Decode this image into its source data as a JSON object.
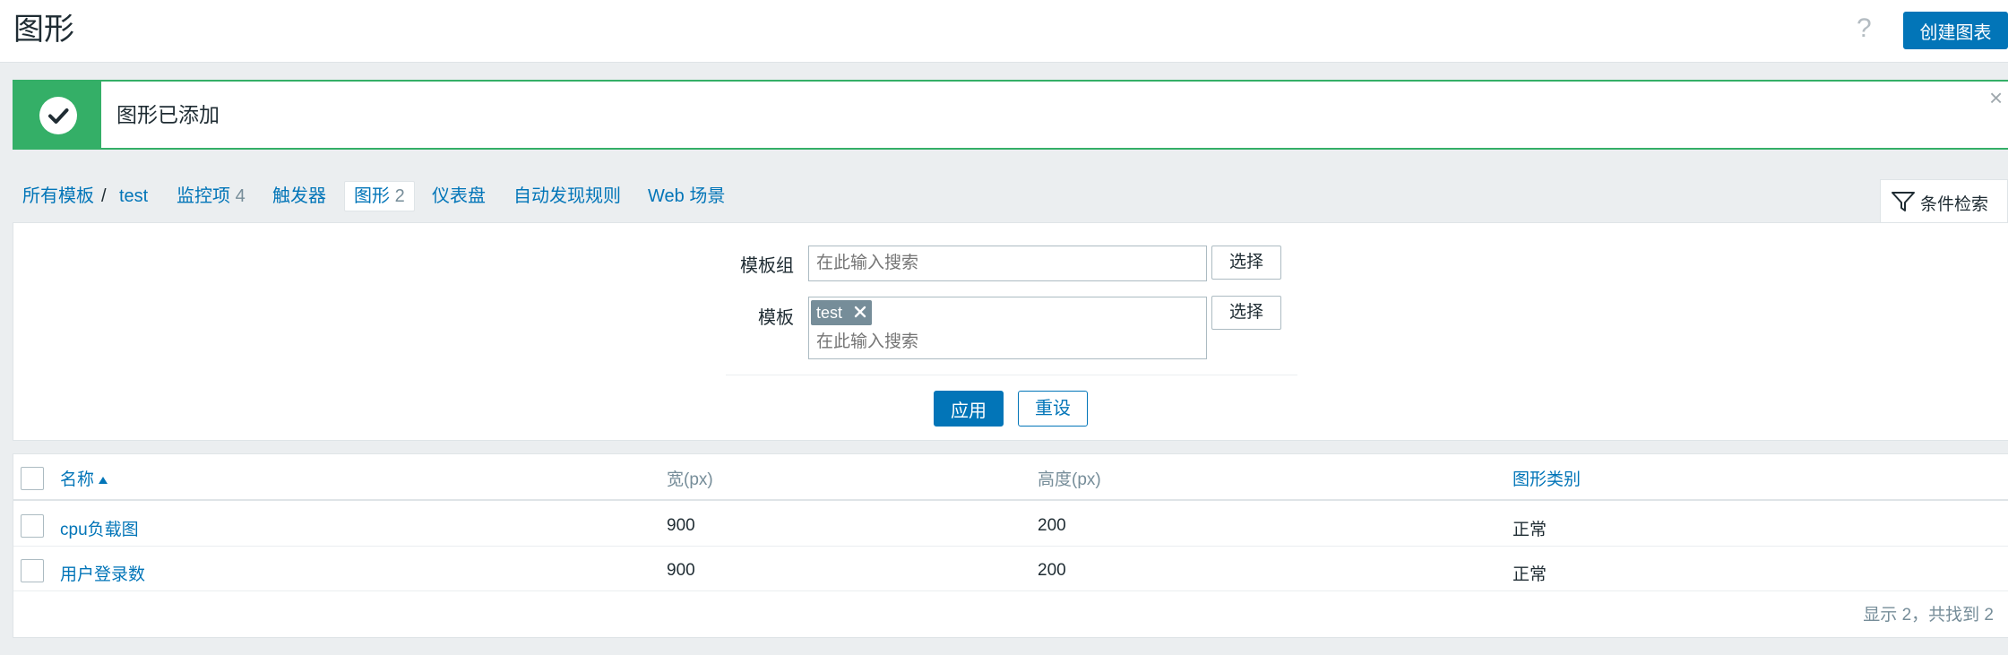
{
  "header": {
    "title": "图形",
    "help_icon": "?",
    "create_button": "创建图表"
  },
  "message": {
    "text": "图形已添加",
    "close": "×",
    "color": "#34af67"
  },
  "breadcrumb": {
    "all_templates": "所有模板",
    "separator": "/",
    "template": "test"
  },
  "tabs": [
    {
      "label": "监控项",
      "count": "4"
    },
    {
      "label": "触发器",
      "count": ""
    },
    {
      "label": "图形",
      "count": "2"
    },
    {
      "label": "仪表盘",
      "count": ""
    },
    {
      "label": "自动发现规则",
      "count": ""
    },
    {
      "label": "Web 场景",
      "count": ""
    }
  ],
  "filter": {
    "tab_label": "条件检索",
    "template_group_label": "模板组",
    "template_label": "模板",
    "placeholder": "在此输入搜索",
    "select_label": "选择",
    "selected_tag": "test",
    "apply_label": "应用",
    "reset_label": "重设"
  },
  "table": {
    "columns": [
      "名称",
      "宽(px)",
      "高度(px)",
      "图形类别"
    ],
    "rows": [
      {
        "name": "cpu负载图",
        "width": "900",
        "height": "200",
        "type": "正常"
      },
      {
        "name": "用户登录数",
        "width": "900",
        "height": "200",
        "type": "正常"
      }
    ],
    "footer": "显示 2，共找到 2"
  },
  "colors": {
    "accent": "#0275b8",
    "success": "#34af67"
  }
}
